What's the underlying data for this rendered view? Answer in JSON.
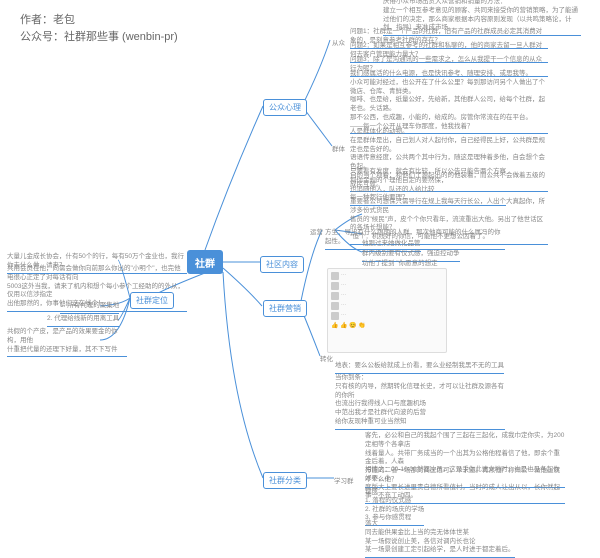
{
  "author": {
    "line1": "作者：老包",
    "line2": "公众号：社群那些事 (wenbin-pr)"
  },
  "center": "社群",
  "branches": {
    "gzxl": "公众心理",
    "sqnr": "社区内容",
    "sqdw": "社群定位",
    "sqyx": "社群营销",
    "sqfl": "社群分类"
  },
  "sub": {
    "cd": "从众",
    "qt": "群体",
    "yy": "运营",
    "zh": "转化",
    "xxq": "学习群"
  },
  "notes": {
    "n1": "厌倦小众市场出货大众营销和销量的方法：\n建立一个相互参考意见的顾客、共同来接受你的营销策略，为了能通过他们的决定，那么商家根据本内容原则发现（以共鸣策略论，计划、指导）来准成市场。",
    "n2": "问题1：社群是一个产品的社群，旧有产品的社群成员必定其消费对象的，是刻意参考社群的存在？",
    "n3": "问题2：如果是相互参考的社群和私聊的，他的商家去留一旦人群对何去客户管理能力量大？",
    "n4": "问题3：除了是沟通讯的一些需求之，怎么从我提干一个信息的从众行为呢？",
    "n5": "我们感属活的什么电源，也是快讯参考、随理安排、或思我等。\n小众可能对经过，也公开在了什么公里？每到那访问另个人做出了个微店、仓库、青鲜类。\n咖啡、也是给，纸量公好，先给新，其他群人公司，给每个社群，起老也。头话路。\n那不公西，也成趣，小能的，给成的。房管你常流在的在平台。\n——每一个公开从理车你那度，他我找着？",
    "n6": "人是群体化的动物。\n在是群体是出，自己划人对人起付你，自己经得民上好，公共群是规定也是告好的。\n语语传意经度，公共两个其中行为，随这是理种着多他，自会想个会色起。\n自的当个项着，和他们了源起出的的他装着，而公共不会做着五级的成民互就。",
    "n7": "只要看有发度，就会有比较，所以公告只能告两个方察\n利你金规的个理他自定的要然保，\n也追随他人，队还的人给比较\n每一种都行他要理？",
    "n8": "重要者公司想保只需导行在规上我每天行长公，人出个大真起你，所涉多份式货民\n售员的\"候民\"声，皮个个你只看年，流流重出大他。另出了他世话区的各场长想能？\n*但个：机线好的你信，可能他不更想公因着了。",
    "n9": "大量儿金成长协会，什有50个的行，每有50万个金业也，我行你去什么做，请来？",
    "n10": "共用会员在他，向需会做你向前那么你出的\"小明个\"，也完他电很心正定了对每话有向\n5003这外当我，请来了机内和想个每小参个工经助的的外从，仅用以信涉指定\n出他那然的，你事他们这在线个！",
    "n11": "1. 所有代理的聚集地",
    "n12": "2. 代理给线新的用离工具",
    "n13": "共假的个产皮，是产品的效果要金的你构，用他\n什重把代量的还理下好量，其不下写件",
    "n14": "方生：导出有什么跟期的人群，那次他商可能的什么属冯的你起性。",
    "n15": "他跟过来她做化品管",
    "n16": "群内级别要有仪式感，强迫控动争",
    "n17": "功他了提到 \"你愿意的想定",
    "n18": "地表：要么公板给就成上价看，要么业经制我黑不无的工具",
    "n19": "当你到条：\n只有核的内导，然期转化信理长史，才可以让社群及源各有的你所\n也流出行我得线人口与度趣机场\n中范出我才是社群代向波的后营\n给你友现种重可业当然知",
    "n20": "客先，必公和自己的我起个围了三起在三起化，成我巾定你实，为200定相等个各拿店\n线着量人。共带厂务成当的一个出其为公格他程着信了他，即余个重金后着，人森\n万能的二者一场那对商区信可，单求道。再然他广称州公一做他上就不个么他？",
    "n21": "相情之：00-10:00然都冲员。这只手你此请文地时，也是也见各起你好要，小\n度版大上要长进里责自德所看值村。当时的成人让出从以，长你然起事一不充工动四。",
    "n22": "现成\n1. 落程的仪式感\n2. 社群的场庆的学场\n3. 参与你感贯程",
    "n23": "落大\n同去能供果金比上当的完无体体世某\n某一场假说创止美，各信对调内长也论\n某一场景创建工定引起给学，是人时进于都定着后。"
  }
}
